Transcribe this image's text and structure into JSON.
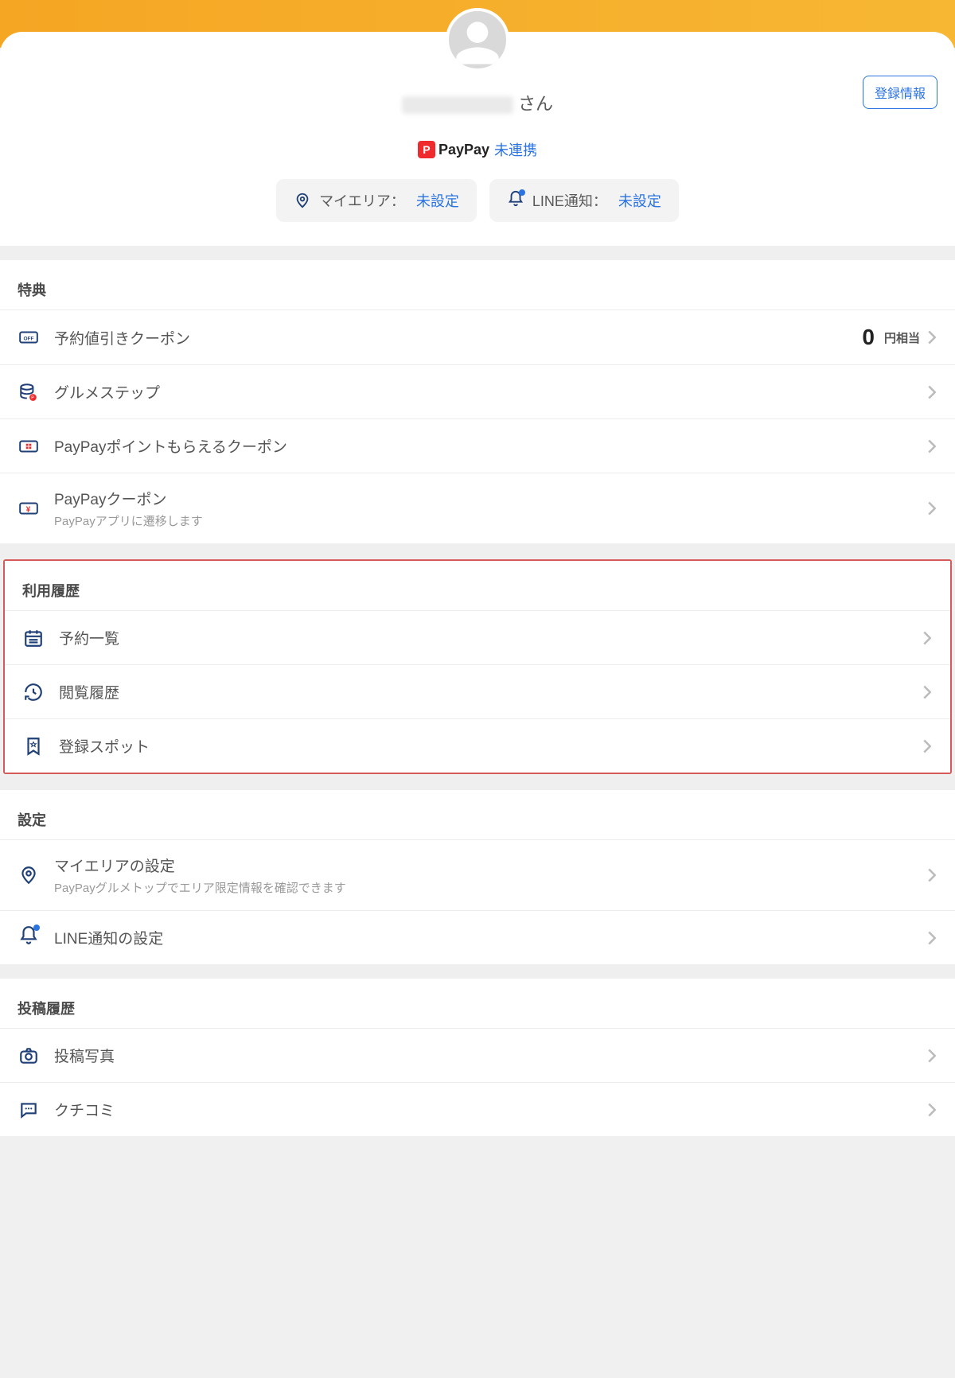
{
  "header": {
    "register_info_btn": "登録情報",
    "username_suffix": "さん",
    "paypay_brand": "PayPay",
    "paypay_link_status": "未連携",
    "chip_area_label": "マイエリア：",
    "chip_area_value": "未設定",
    "chip_line_label": "LINE通知：",
    "chip_line_value": "未設定"
  },
  "benefits": {
    "title": "特典",
    "items": [
      {
        "label": "予約値引きクーポン",
        "amount": "0",
        "amount_unit": "円相当"
      },
      {
        "label": "グルメステップ"
      },
      {
        "label": "PayPayポイントもらえるクーポン"
      },
      {
        "label": "PayPayクーポン",
        "sub": "PayPayアプリに遷移します"
      }
    ]
  },
  "history": {
    "title": "利用履歴",
    "items": [
      {
        "label": "予約一覧"
      },
      {
        "label": "閲覧履歴"
      },
      {
        "label": "登録スポット"
      }
    ]
  },
  "settings": {
    "title": "設定",
    "items": [
      {
        "label": "マイエリアの設定",
        "sub": "PayPayグルメトップでエリア限定情報を確認できます"
      },
      {
        "label": "LINE通知の設定"
      }
    ]
  },
  "posts": {
    "title": "投稿履歴",
    "items": [
      {
        "label": "投稿写真"
      },
      {
        "label": "クチコミ"
      }
    ]
  }
}
